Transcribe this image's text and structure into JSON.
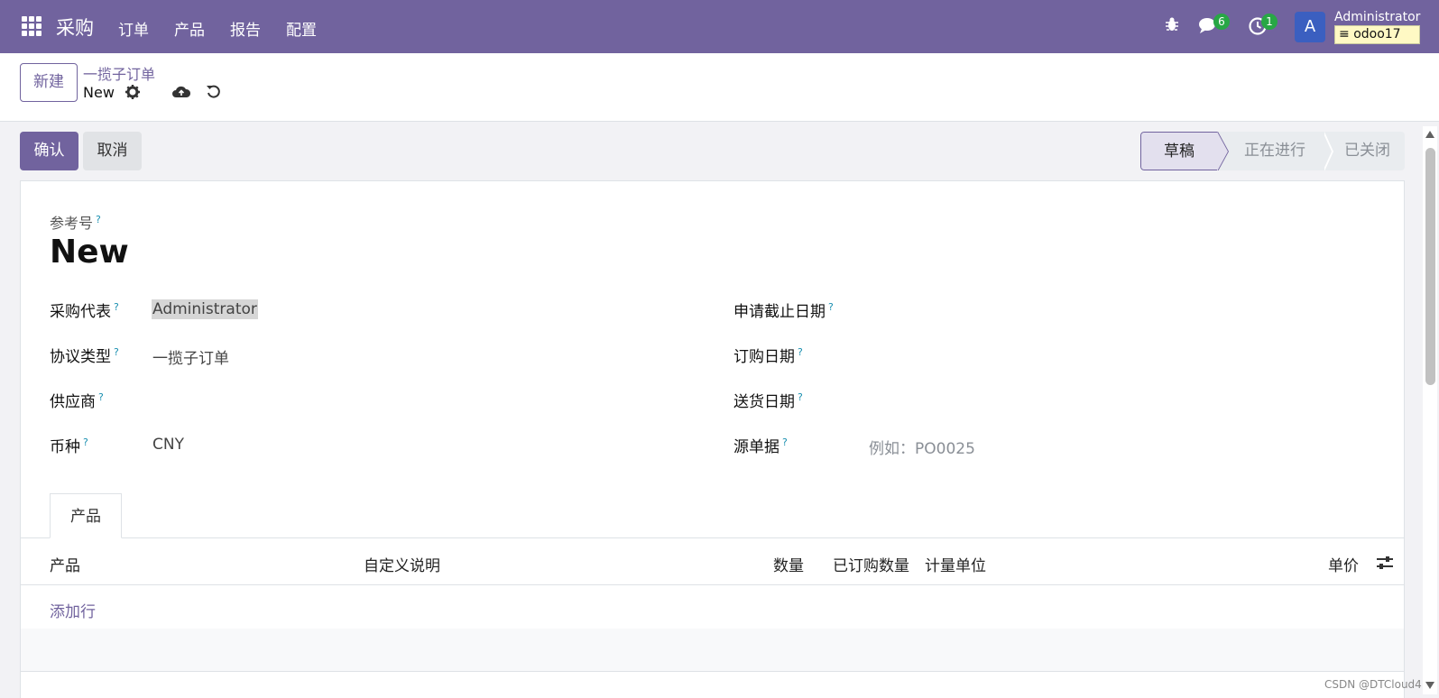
{
  "topbar": {
    "brand": "采购",
    "menus": [
      "订单",
      "产品",
      "报告",
      "配置"
    ],
    "messages_count": "6",
    "activities_count": "1",
    "avatar_letter": "A",
    "username": "Administrator",
    "database": "odoo17"
  },
  "control_panel": {
    "new_button": "新建",
    "breadcrumb_parent": "一揽子订单",
    "breadcrumb_current": "New"
  },
  "actions": {
    "confirm": "确认",
    "cancel": "取消"
  },
  "statusbar": {
    "stages": [
      "草稿",
      "正在进行",
      "已关闭"
    ],
    "active": "草稿"
  },
  "form": {
    "reference_label": "参考号",
    "reference_value": "New",
    "help_mark": "?",
    "left_fields": [
      {
        "label": "采购代表",
        "value": "Administrator"
      },
      {
        "label": "协议类型",
        "value": "一揽子订单"
      },
      {
        "label": "供应商",
        "value": ""
      },
      {
        "label": "币种",
        "value": "CNY"
      }
    ],
    "right_fields": [
      {
        "label": "申请截止日期",
        "value": ""
      },
      {
        "label": "订购日期",
        "value": ""
      },
      {
        "label": "送货日期",
        "value": ""
      },
      {
        "label": "源单据",
        "placeholder": "例如：PO0025"
      }
    ]
  },
  "tabs": [
    "产品"
  ],
  "lines_table": {
    "columns": [
      "产品",
      "自定义说明",
      "数量",
      "已订购数量",
      "计量单位",
      "单价"
    ],
    "add_line": "添加行"
  },
  "watermark": "CSDN @DTCloud4"
}
